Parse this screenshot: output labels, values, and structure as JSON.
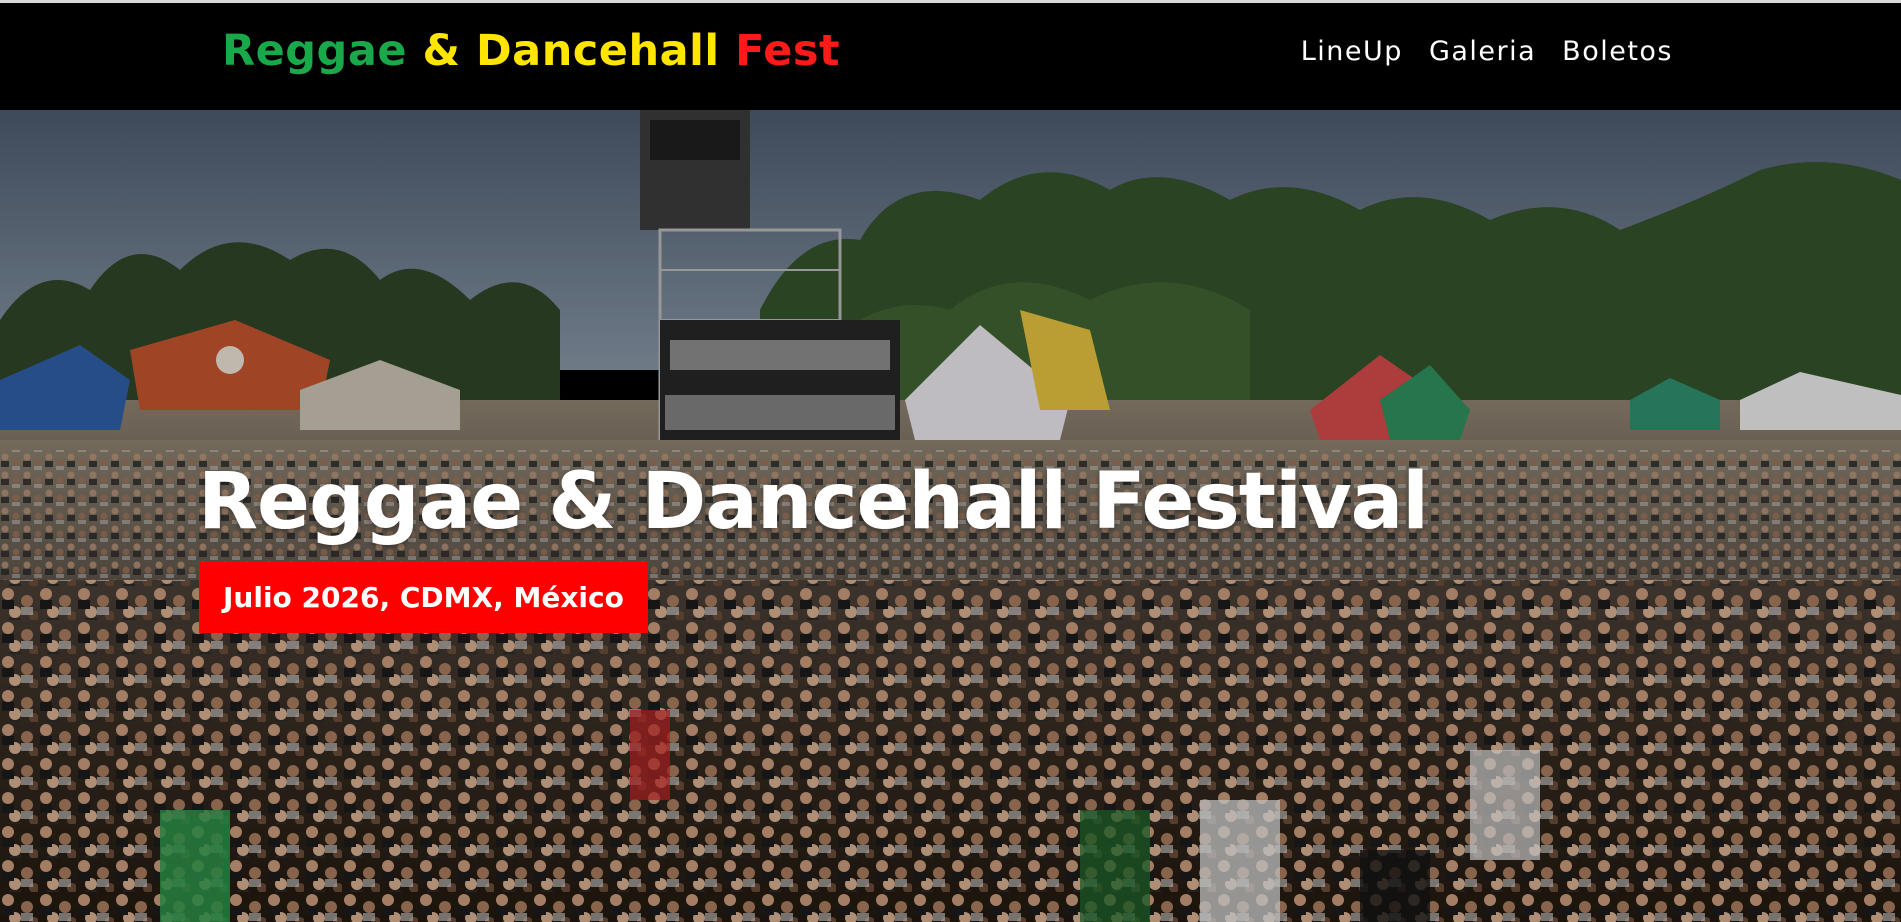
{
  "header": {
    "logo_parts": [
      "Reggae",
      "&",
      "Dancehall",
      "Fest"
    ],
    "nav": [
      {
        "label": "LineUp"
      },
      {
        "label": "Galeria"
      },
      {
        "label": "Boletos"
      }
    ]
  },
  "hero": {
    "title": "Reggae & Dancehall Festival",
    "badge": "Julio 2026, CDMX, México"
  },
  "colors": {
    "header_bg": "#000000",
    "logo_green": "#19a94a",
    "logo_yellow": "#ffe500",
    "logo_red": "#ff1a1a",
    "badge_bg": "#ff0000",
    "text": "#ffffff"
  }
}
